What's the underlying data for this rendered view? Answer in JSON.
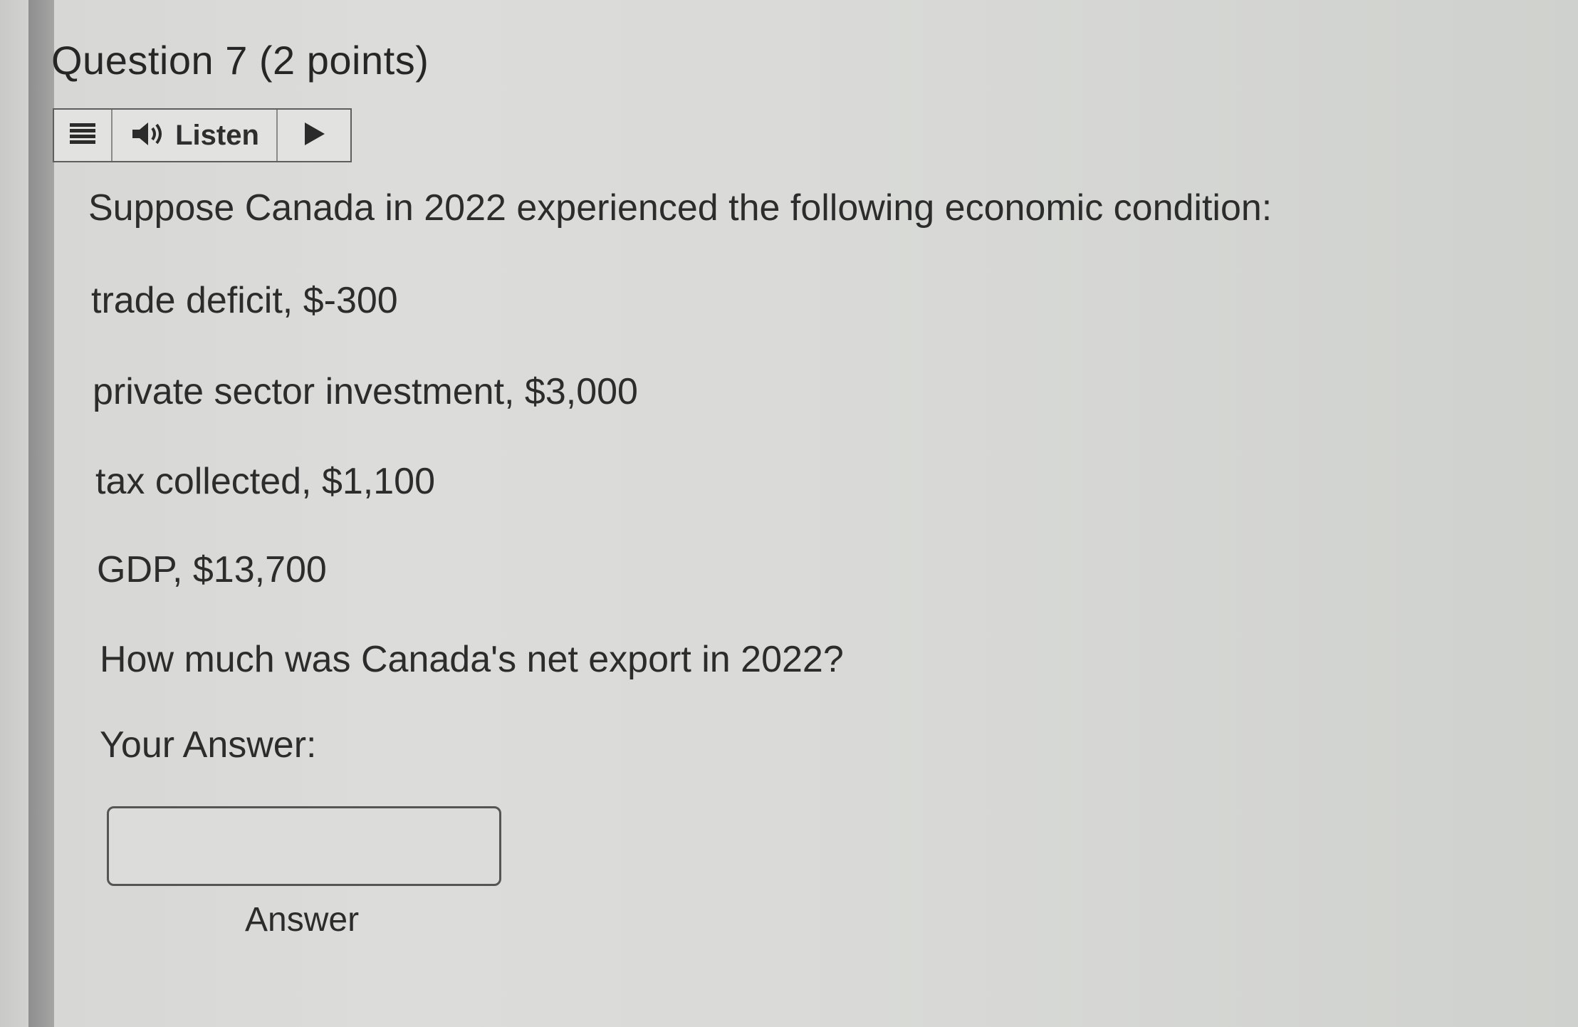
{
  "question": {
    "label": "Question 7",
    "points": "(2 points)"
  },
  "listen_toolbar": {
    "menu_icon": "menu-icon",
    "speaker_icon": "speaker-icon",
    "listen_label": "Listen",
    "play_icon": "play-icon"
  },
  "body": {
    "intro": "Suppose Canada in 2022 experienced the following economic condition:",
    "conditions": [
      "trade deficit, $-300",
      "private sector investment, $3,000",
      "tax collected, $1,100",
      "GDP, $13,700"
    ],
    "prompt": "How much was Canada's net export in 2022?"
  },
  "answer": {
    "label": "Your Answer:",
    "value": "",
    "caption": "Answer"
  },
  "colors": {
    "background": "#d9d9d7",
    "left_bar": "#9b9b9b",
    "text": "#2c2c2c",
    "border": "#555555"
  }
}
